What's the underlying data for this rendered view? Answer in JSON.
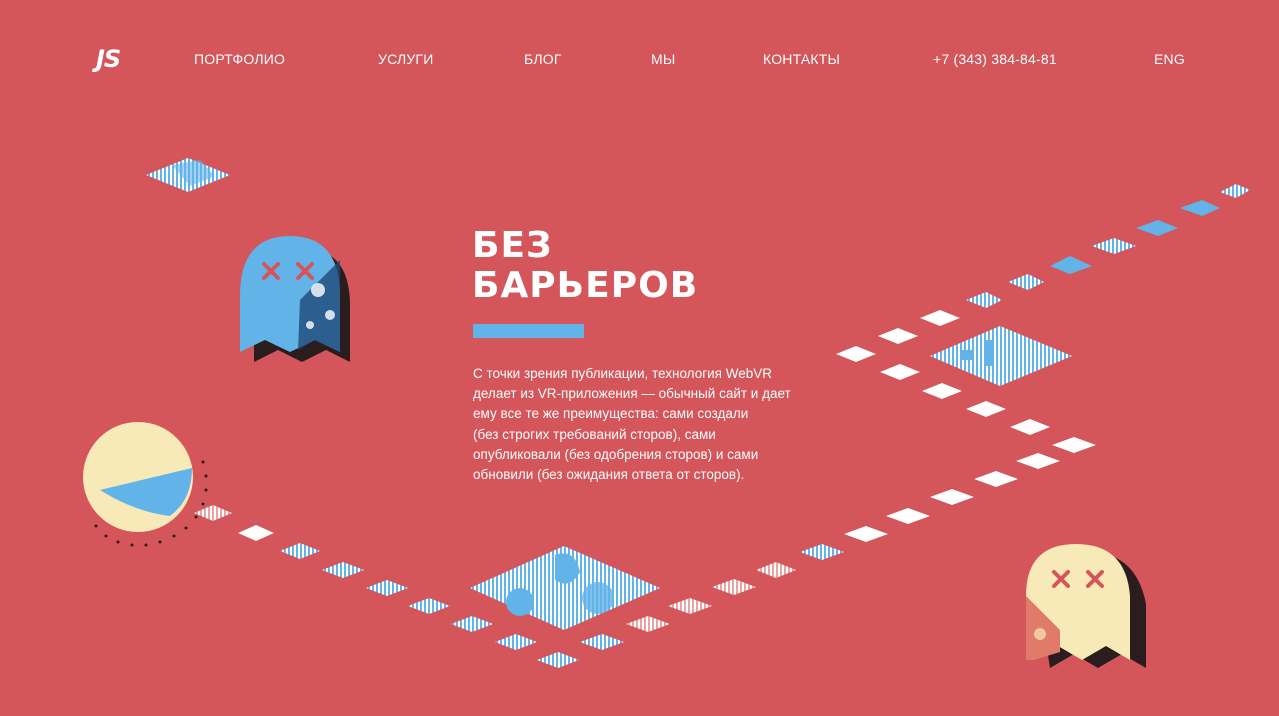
{
  "nav": {
    "logo": "JS",
    "items": [
      {
        "label": "ПОРТФОЛИО"
      },
      {
        "label": "УСЛУГИ"
      },
      {
        "label": "БЛОГ"
      },
      {
        "label": "МЫ"
      },
      {
        "label": "КОНТАКТЫ"
      }
    ],
    "phone": "+7 (343) 384-84-81",
    "lang": "ENG"
  },
  "hero": {
    "title_line1": "БЕЗ",
    "title_line2": "БАРЬЕРОВ",
    "accent_color": "#62b4e8",
    "text_lines": [
      "С точки зрения публикации, технология WebVR",
      "делает из VR-приложения — обычный сайт и дает",
      "ему все те же преимущества: сами создали",
      "(без строгих требований сторов), сами",
      "опубликовали (без одобрения сторов) и сами",
      "обновили (без ожидания ответа от сторов)."
    ]
  },
  "colors": {
    "background": "#d4555a",
    "accent_blue": "#62b4e8",
    "cream": "#f7eab8",
    "dark": "#2b1d1e",
    "white": "#ffffff"
  },
  "icons": [
    "logo-icon",
    "dead-ghost-icon",
    "pacman-icon",
    "dead-ghost-icon"
  ]
}
